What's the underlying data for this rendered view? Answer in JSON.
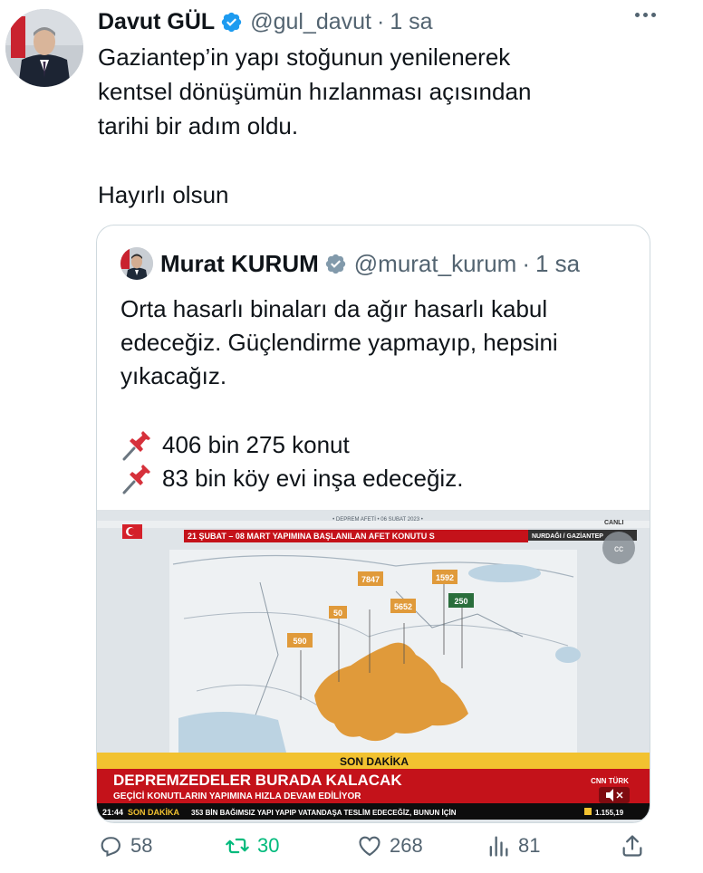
{
  "tweet": {
    "author_name": "Davut GÜL",
    "handle": "@gul_davut",
    "separator": "·",
    "time": "1 sa",
    "text": "Gaziantep’in yapı stoğunun yenilenerek\nkentsel dönüşümün hızlanması açısından\ntarihi bir adım oldu.\n\nHayırlı olsun"
  },
  "quote": {
    "author_name": "Murat KURUM",
    "handle": "@murat_kurum",
    "separator": "·",
    "time": "1 sa",
    "text": "Orta hasarlı binaları da ağır hasarlı kabul\nedeceğiz. Güçlendirme yapmayıp, hepsini\nyıkacağız.",
    "line1": "406 bin 275 konut",
    "line2": "83 bin köy evi inşa edeceğiz.",
    "media": {
      "top_label": "• DEPREM AFETİ • 06 ŞUBAT 2023 •",
      "banner": "21 ŞUBAT – 08 MART YAPIMINA BAŞLANILAN AFET KONUTU S",
      "location": "NURDAĞI / GAZİANTEP",
      "canli": "CANLI",
      "markers": [
        "7847",
        "1592",
        "50",
        "5652",
        "250",
        "590"
      ],
      "son_dakika": "SON DAKİKA",
      "headline": "DEPREMZEDELER BURADA KALACAK",
      "subheadline": "GEÇİCİ KONUTLARIN YAPIMINA HIZLA DEVAM EDİLİYOR",
      "ticker_time": "21:44",
      "ticker_label": "SON DAKİKA",
      "ticker_text": "353 BİN BAĞIMSIZ YAPI YAPIP VATANDAŞA TESLİM EDECEĞİZ, BUNUN İÇİN",
      "ticker_value": "1.155,19",
      "channel": "CNN TÜRK",
      "colors": {
        "region": "#e09a3a",
        "banner_red": "#c4121a",
        "son_dakika_yellow": "#f2c230"
      }
    }
  },
  "actions": {
    "replies": "58",
    "retweets": "30",
    "likes": "268",
    "views": "81"
  }
}
